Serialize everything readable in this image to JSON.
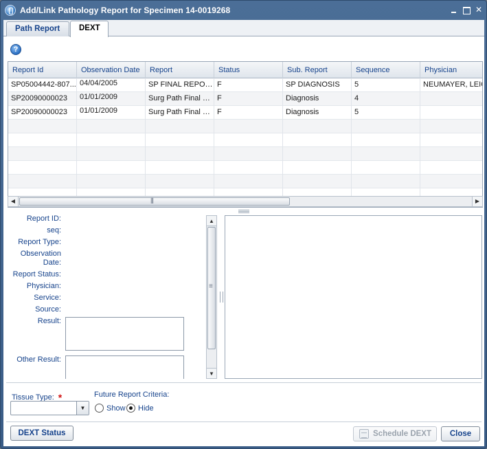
{
  "window": {
    "title": "Add/Link Pathology Report for Specimen 14-0019268"
  },
  "tabs": [
    {
      "label": "Path Report"
    },
    {
      "label": "DEXT"
    }
  ],
  "help": {
    "glyph": "?"
  },
  "grid": {
    "columns": [
      "Report Id",
      "Observation Date",
      "Report",
      "Status",
      "Sub. Report",
      "Sequence",
      "Physician"
    ],
    "rows": [
      [
        "SP05004442-807...",
        "04/04/2005",
        "SP FINAL REPORT",
        "F",
        "SP DIAGNOSIS",
        "5",
        "NEUMAYER, LEIGH"
      ],
      [
        "SP20090000023",
        "01/01/2009",
        "Surg Path Final R...",
        "F",
        "Diagnosis",
        "4",
        ""
      ],
      [
        "SP20090000023",
        "01/01/2009",
        "Surg Path Final R...",
        "F",
        "Diagnosis",
        "5",
        ""
      ]
    ]
  },
  "detail": {
    "report_id": "Report ID:",
    "seq": "seq:",
    "report_type": "Report Type:",
    "observation_1": "Observation",
    "observation_2": "Date:",
    "report_status": "Report Status:",
    "physician": "Physician:",
    "service": "Service:",
    "source": "Source:",
    "result": "Result:",
    "other_result": "Other Result:"
  },
  "form": {
    "tissue_type_label": "Tissue Type:",
    "required_mark": "*",
    "future_label": "Future Report Criteria:",
    "show_label": "Show",
    "hide_label": "Hide",
    "selected": "Hide"
  },
  "buttons": {
    "dext_status": "DEXT Status",
    "schedule_dext": "Schedule DEXT",
    "close": "Close"
  }
}
